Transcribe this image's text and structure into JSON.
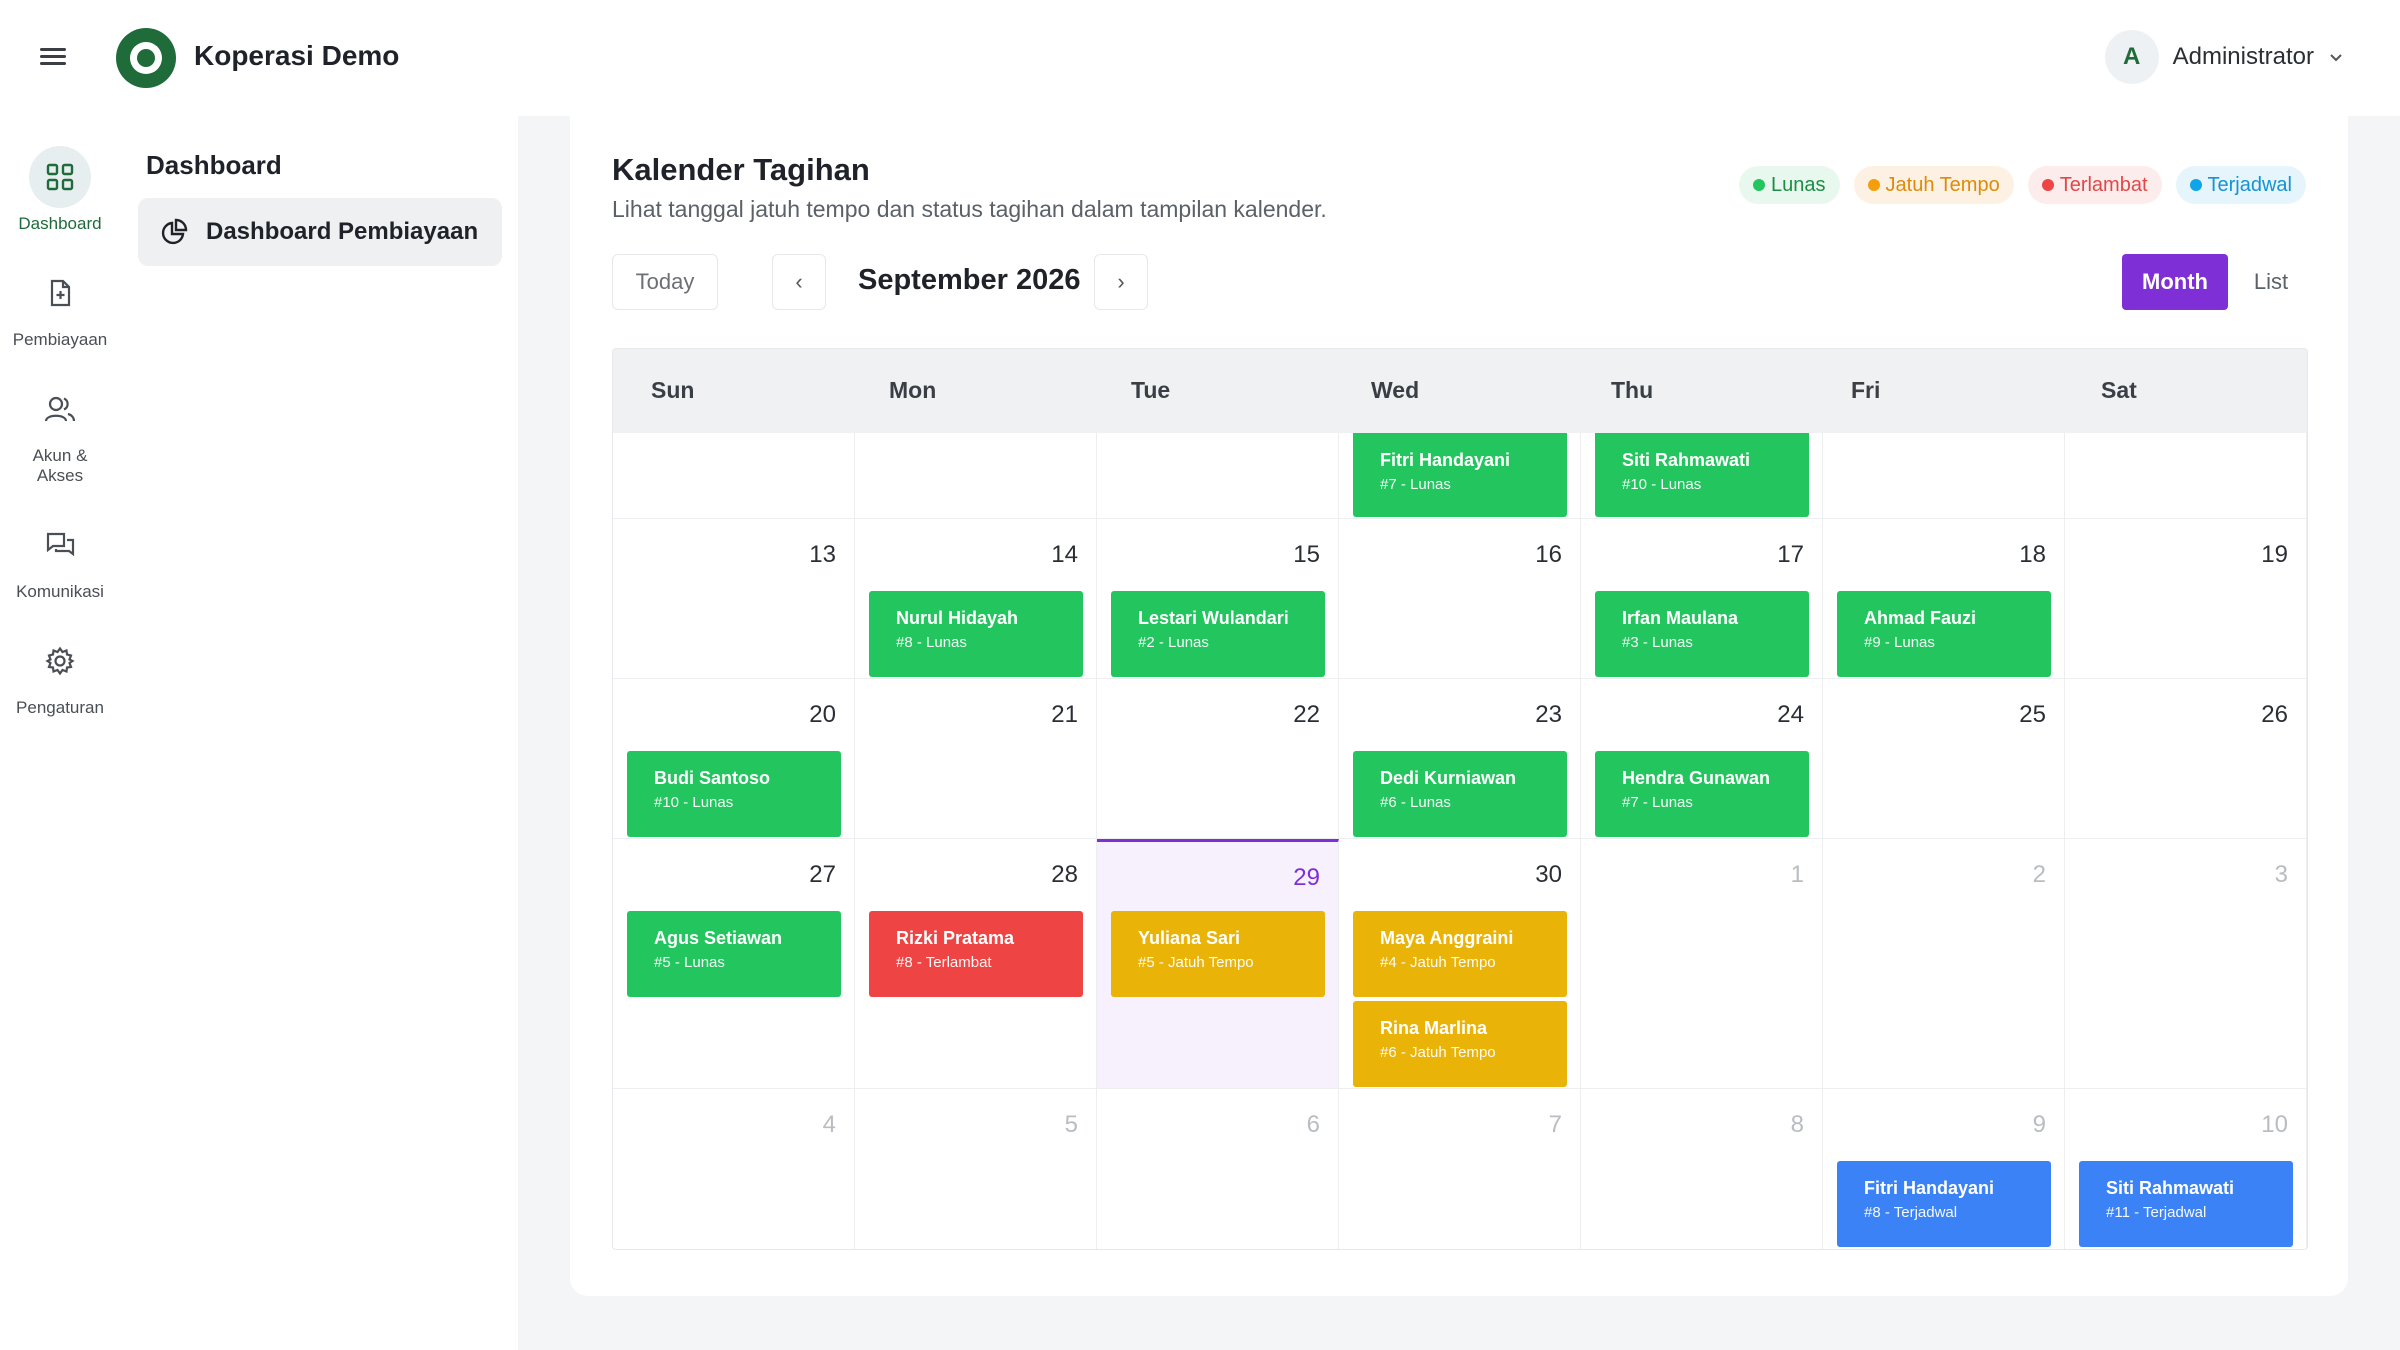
{
  "header": {
    "brand": "Koperasi Demo",
    "user_initial": "A",
    "user_name": "Administrator"
  },
  "rail": [
    {
      "label": "Dashboard",
      "icon": "grid-icon"
    },
    {
      "label": "Pembiayaan",
      "icon": "document-plus-icon"
    },
    {
      "label": "Akun & Akses",
      "icon": "users-icon"
    },
    {
      "label": "Komunikasi",
      "icon": "chat-icon"
    },
    {
      "label": "Pengaturan",
      "icon": "gear-icon"
    }
  ],
  "subnav": {
    "title": "Dashboard",
    "item": "Dashboard Pembiayaan"
  },
  "page": {
    "title": "Kalender Tagihan",
    "subtitle": "Lihat tanggal jatuh tempo dan status tagihan dalam tampilan kalender."
  },
  "legend": [
    {
      "label": "Lunas",
      "color": "#22c55e",
      "bg": "#e9f8ee",
      "text": "#1a8f44"
    },
    {
      "label": "Jatuh Tempo",
      "color": "#f59e0b",
      "bg": "#fdf1e3",
      "text": "#e08a0a"
    },
    {
      "label": "Terlambat",
      "color": "#ef4444",
      "bg": "#fdecec",
      "text": "#e04848"
    },
    {
      "label": "Terjadwal",
      "color": "#0ea5e9",
      "bg": "#e6f4fb",
      "text": "#1593d2"
    }
  ],
  "toolbar": {
    "today": "Today",
    "prev": "‹",
    "next": "›",
    "month_label": "September 2026",
    "month_btn": "Month",
    "list_btn": "List"
  },
  "weekdays": [
    "Sun",
    "Mon",
    "Tue",
    "Wed",
    "Thu",
    "Fri",
    "Sat"
  ],
  "weeks": [
    [
      {
        "num": "",
        "events": []
      },
      {
        "num": "",
        "events": []
      },
      {
        "num": "",
        "events": []
      },
      {
        "num": "",
        "events": [
          {
            "name": "Fitri Handayani",
            "sub": "#7 - Lunas",
            "status": "green"
          }
        ]
      },
      {
        "num": "",
        "events": [
          {
            "name": "Siti Rahmawati",
            "sub": "#10 - Lunas",
            "status": "green"
          }
        ]
      },
      {
        "num": "",
        "events": []
      },
      {
        "num": "",
        "events": []
      }
    ],
    [
      {
        "num": "13",
        "events": []
      },
      {
        "num": "14",
        "events": [
          {
            "name": "Nurul Hidayah",
            "sub": "#8 - Lunas",
            "status": "green"
          }
        ]
      },
      {
        "num": "15",
        "events": [
          {
            "name": "Lestari Wulandari",
            "sub": "#2 - Lunas",
            "status": "green"
          }
        ]
      },
      {
        "num": "16",
        "events": []
      },
      {
        "num": "17",
        "events": [
          {
            "name": "Irfan Maulana",
            "sub": "#3 - Lunas",
            "status": "green"
          }
        ]
      },
      {
        "num": "18",
        "events": [
          {
            "name": "Ahmad Fauzi",
            "sub": "#9 - Lunas",
            "status": "green"
          }
        ]
      },
      {
        "num": "19",
        "events": []
      }
    ],
    [
      {
        "num": "20",
        "events": [
          {
            "name": "Budi Santoso",
            "sub": "#10 - Lunas",
            "status": "green"
          }
        ]
      },
      {
        "num": "21",
        "events": []
      },
      {
        "num": "22",
        "events": []
      },
      {
        "num": "23",
        "events": [
          {
            "name": "Dedi Kurniawan",
            "sub": "#6 - Lunas",
            "status": "green"
          }
        ]
      },
      {
        "num": "24",
        "events": [
          {
            "name": "Hendra Gunawan",
            "sub": "#7 - Lunas",
            "status": "green"
          }
        ]
      },
      {
        "num": "25",
        "events": []
      },
      {
        "num": "26",
        "events": []
      }
    ],
    [
      {
        "num": "27",
        "events": [
          {
            "name": "Agus Setiawan",
            "sub": "#5 - Lunas",
            "status": "green"
          }
        ]
      },
      {
        "num": "28",
        "events": [
          {
            "name": "Rizki Pratama",
            "sub": "#8 - Terlambat",
            "status": "red"
          }
        ]
      },
      {
        "num": "29",
        "today": true,
        "events": [
          {
            "name": "Yuliana Sari",
            "sub": "#5 - Jatuh Tempo",
            "status": "yellow"
          }
        ]
      },
      {
        "num": "30",
        "events": [
          {
            "name": "Maya Anggraini",
            "sub": "#4 - Jatuh Tempo",
            "status": "yellow"
          },
          {
            "name": "Rina Marlina",
            "sub": "#6 - Jatuh Tempo",
            "status": "yellow"
          }
        ]
      },
      {
        "num": "1",
        "muted": true,
        "events": []
      },
      {
        "num": "2",
        "muted": true,
        "events": []
      },
      {
        "num": "3",
        "muted": true,
        "events": []
      }
    ],
    [
      {
        "num": "4",
        "muted": true,
        "events": []
      },
      {
        "num": "5",
        "muted": true,
        "events": []
      },
      {
        "num": "6",
        "muted": true,
        "events": []
      },
      {
        "num": "7",
        "muted": true,
        "events": []
      },
      {
        "num": "8",
        "muted": true,
        "events": []
      },
      {
        "num": "9",
        "muted": true,
        "events": [
          {
            "name": "Fitri Handayani",
            "sub": "#8 - Terjadwal",
            "status": "blue"
          }
        ]
      },
      {
        "num": "10",
        "muted": true,
        "events": [
          {
            "name": "Siti Rahmawati",
            "sub": "#11 - Terjadwal",
            "status": "blue"
          }
        ]
      }
    ]
  ]
}
